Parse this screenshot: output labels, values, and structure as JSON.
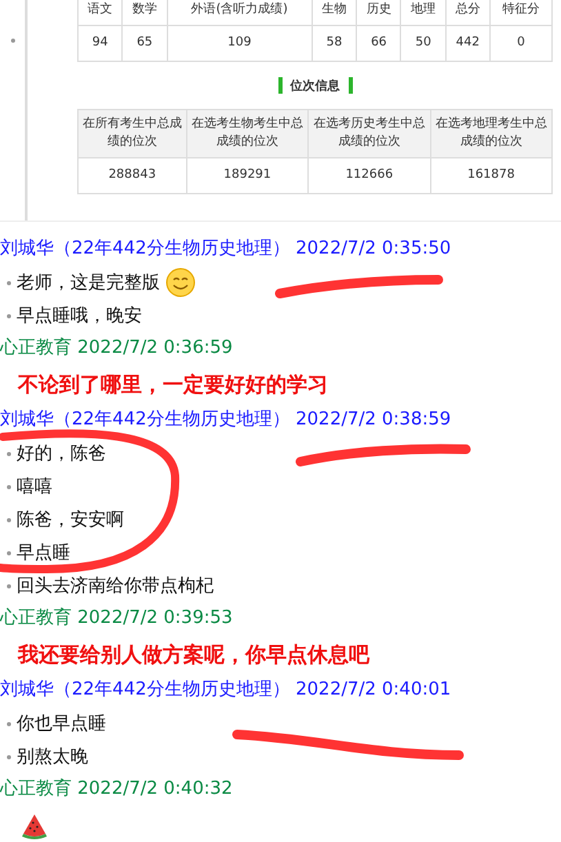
{
  "score_table": {
    "columns": [
      "语文",
      "数学",
      "外语(含听力成绩)",
      "生物",
      "历史",
      "地理",
      "总分",
      "特征分"
    ],
    "rows": [
      [
        "94",
        "65",
        "109",
        "58",
        "66",
        "50",
        "442",
        "0"
      ]
    ]
  },
  "rank_section": {
    "title": "位次信息",
    "columns": [
      "在所有考生中总成绩的位次",
      "在选考生物考生中总成绩的位次",
      "在选考历史考生中总成绩的位次",
      "在选考地理考生中总成绩的位次"
    ],
    "rows": [
      [
        "288843",
        "189291",
        "112666",
        "161878"
      ]
    ]
  },
  "messages": [
    {
      "kind": "student",
      "sender": "刘城华（22年442分生物历史地理）",
      "time": "2022/7/2 0:35:50",
      "items": [
        {
          "kind": "text",
          "text": "老师，这是完整版",
          "emoji": true
        },
        {
          "kind": "text",
          "text": "早点睡哦，晚安",
          "emoji": false
        }
      ]
    },
    {
      "kind": "teacher",
      "sender": "心正教育",
      "time": "2022/7/2 0:36:59",
      "items": [
        {
          "kind": "note",
          "text": "不论到了哪里，一定要好好的学习"
        }
      ]
    },
    {
      "kind": "student",
      "sender": "刘城华（22年442分生物历史地理）",
      "time": "2022/7/2 0:38:59",
      "items": [
        {
          "kind": "text",
          "text": "好的，陈爸",
          "emoji": false
        },
        {
          "kind": "text",
          "text": "嘻嘻",
          "emoji": false
        },
        {
          "kind": "text",
          "text": "陈爸，安安啊",
          "emoji": false
        },
        {
          "kind": "text",
          "text": "早点睡",
          "emoji": false
        },
        {
          "kind": "text",
          "text": "回头去济南给你带点枸杞",
          "emoji": false
        }
      ]
    },
    {
      "kind": "teacher",
      "sender": "心正教育",
      "time": "2022/7/2 0:39:53",
      "items": [
        {
          "kind": "note",
          "text": "我还要给别人做方案呢，你早点休息吧"
        }
      ]
    },
    {
      "kind": "student",
      "sender": "刘城华（22年442分生物历史地理）",
      "time": "2022/7/2 0:40:01",
      "items": [
        {
          "kind": "text",
          "text": "你也早点睡",
          "emoji": false
        },
        {
          "kind": "text",
          "text": "别熬太晚",
          "emoji": false
        }
      ]
    },
    {
      "kind": "teacher",
      "sender": "心正教育",
      "time": "2022/7/2 0:40:32",
      "items": [
        {
          "kind": "sticker"
        }
      ]
    }
  ]
}
